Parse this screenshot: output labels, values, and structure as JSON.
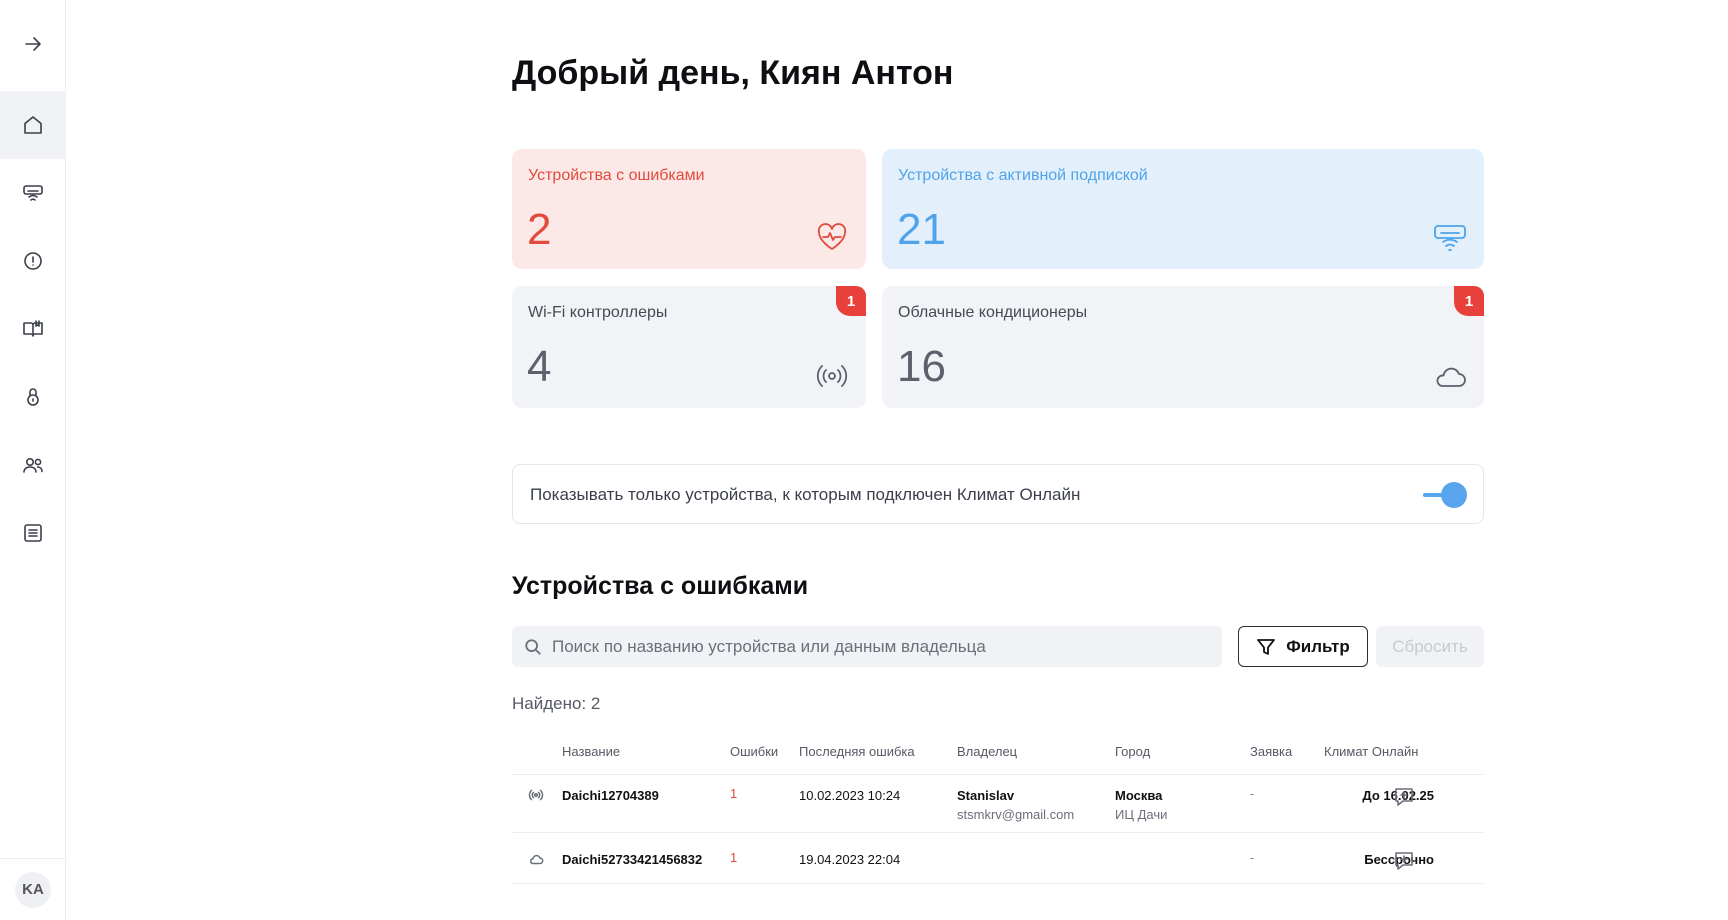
{
  "user": {
    "initials": "KA"
  },
  "greeting": "Добрый день, Киян Антон",
  "cards": {
    "errors": {
      "title": "Устройства с ошибками",
      "value": "2",
      "icon": "heart-pulse-icon",
      "color": "#e04b3c"
    },
    "active": {
      "title": "Устройства с активной подпиской",
      "value": "21",
      "icon": "air-conditioner-icon",
      "color": "#4ea3ea"
    },
    "wifi": {
      "title": "Wi-Fi контроллеры",
      "value": "4",
      "icon": "wireless-icon",
      "badge": "1"
    },
    "cloud": {
      "title": "Облачные кондиционеры",
      "value": "16",
      "icon": "cloud-icon",
      "badge": "1"
    }
  },
  "toggle": {
    "label": "Показывать только устройства, к которым подключен Климат Онлайн",
    "on": true
  },
  "section": {
    "title": "Устройства с ошибками"
  },
  "search": {
    "placeholder": "Поиск по названию устройства или данным владельца",
    "value": ""
  },
  "buttons": {
    "filter": "Фильтр",
    "reset": "Сбросить"
  },
  "found": "Найдено: 2",
  "table": {
    "headers": [
      "Название",
      "Ошибки",
      "Последняя ошибка",
      "Владелец",
      "Город",
      "Заявка",
      "Климат Онлайн"
    ],
    "rows": [
      {
        "icon": "wireless-icon",
        "name": "Daichi12704389",
        "errors": "1",
        "last_error": "10.02.2023 10:24",
        "owner": "Stanislav",
        "owner_email": "stsmkrv@gmail.com",
        "city": "Москва",
        "city_sub": "ИЦ Дачи",
        "request": "-",
        "climate": "До 16.02.25"
      },
      {
        "icon": "cloud-icon",
        "name": "Daichi52733421456832",
        "errors": "1",
        "last_error": "19.04.2023 22:04",
        "owner": "",
        "owner_email": "",
        "city": "",
        "city_sub": "",
        "request": "-",
        "climate": "Бессрочно"
      }
    ]
  }
}
